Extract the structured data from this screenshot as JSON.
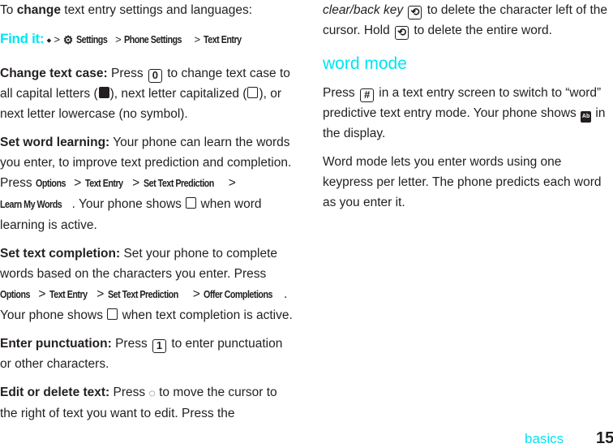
{
  "left": {
    "intro": {
      "pre": "To ",
      "bold": "change",
      "post": " text entry settings and languages:"
    },
    "find_it": {
      "label": "Find it:",
      "nav_icon": "nav-key-center-icon",
      "settings_icon": "settings-gear-icon",
      "path": [
        "Settings",
        "Phone Settings",
        "Text Entry"
      ],
      "separator": ">"
    },
    "change_case": {
      "lead": "Change text case:",
      "t1": " Press ",
      "key": "0",
      "t2": " to change text case to all capital letters (",
      "t3": "), next letter capitalized (",
      "t4": "), or next letter lowercase (no symbol)."
    },
    "word_learning": {
      "lead": "Set word learning:",
      "t1": " Your phone can learn the words you enter, to improve text prediction and completion. Press ",
      "path": [
        "Options",
        "Text Entry",
        "Set Text Prediction",
        "Learn My Words"
      ],
      "t2": ". Your phone shows ",
      "t3": " when word learning is active."
    },
    "text_completion": {
      "lead": "Set text completion:",
      "t1": " Set your phone to complete words based on the characters you enter. Press ",
      "path": [
        "Options",
        "Text Entry",
        "Set Text Prediction",
        "Offer Completions"
      ],
      "t2": ". Your phone shows ",
      "t3": " when text completion is active."
    },
    "punctuation": {
      "lead": "Enter punctuation:",
      "t1": " Press ",
      "key": "1",
      "t2": " to enter punctuation or other characters."
    },
    "edit_delete": {
      "lead": "Edit or delete text:",
      "t1": " Press ",
      "t2": " to move the cursor to the right of text you want to edit. Press the"
    }
  },
  "right": {
    "cont": {
      "italic": "clear/back key",
      "t1": " to delete the character left of the cursor. Hold ",
      "t2": " to delete the entire word.",
      "key_symbol": "⟲"
    },
    "heading": "word mode",
    "para1": {
      "t1": "Press ",
      "key": "#",
      "t2": " in a text entry screen to switch to “word” predictive text entry mode. Your phone shows ",
      "ab": "Ab",
      "t3": " in the display."
    },
    "para2": "Word mode lets you enter words using one keypress per letter. The phone predicts each word as you enter it."
  },
  "footer": {
    "section": "basics",
    "page": "15"
  },
  "colors": {
    "accent": "#00e5f2",
    "text": "#231f20"
  }
}
